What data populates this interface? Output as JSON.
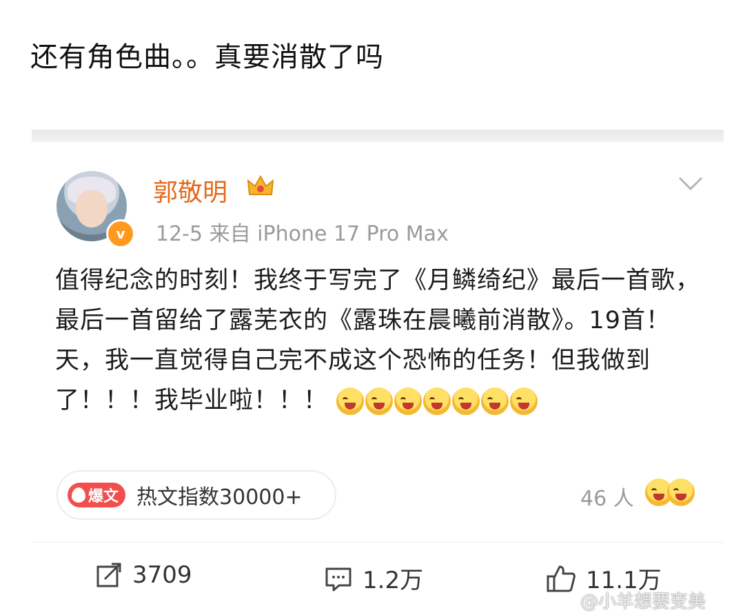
{
  "caption": "还有角色曲。。真要消散了吗",
  "post": {
    "author": "郭敬明",
    "verified_mark": "v",
    "meta": "12-5  来自 iPhone 17 Pro Max",
    "body": "值得纪念的时刻！我终于写完了《月鳞绮纪》最后一首歌，最后一首留给了露芜衣的《露珠在晨曦前消散》。19首！天，我一直觉得自己完不成这个恐怖的任务！但我做到了！！！我毕业啦！！！",
    "hot_badge": "爆文",
    "hot_text": "热文指数30000+",
    "likes_people": "46 人"
  },
  "actions": {
    "repost_count": "3709",
    "comment_count": "1.2万",
    "like_count": "11.1万"
  },
  "watermark": "@小羊想要变美",
  "colors": {
    "username": "#e36a1d",
    "hot_badge": "#f24e4e",
    "verified": "#ff9a1f"
  }
}
